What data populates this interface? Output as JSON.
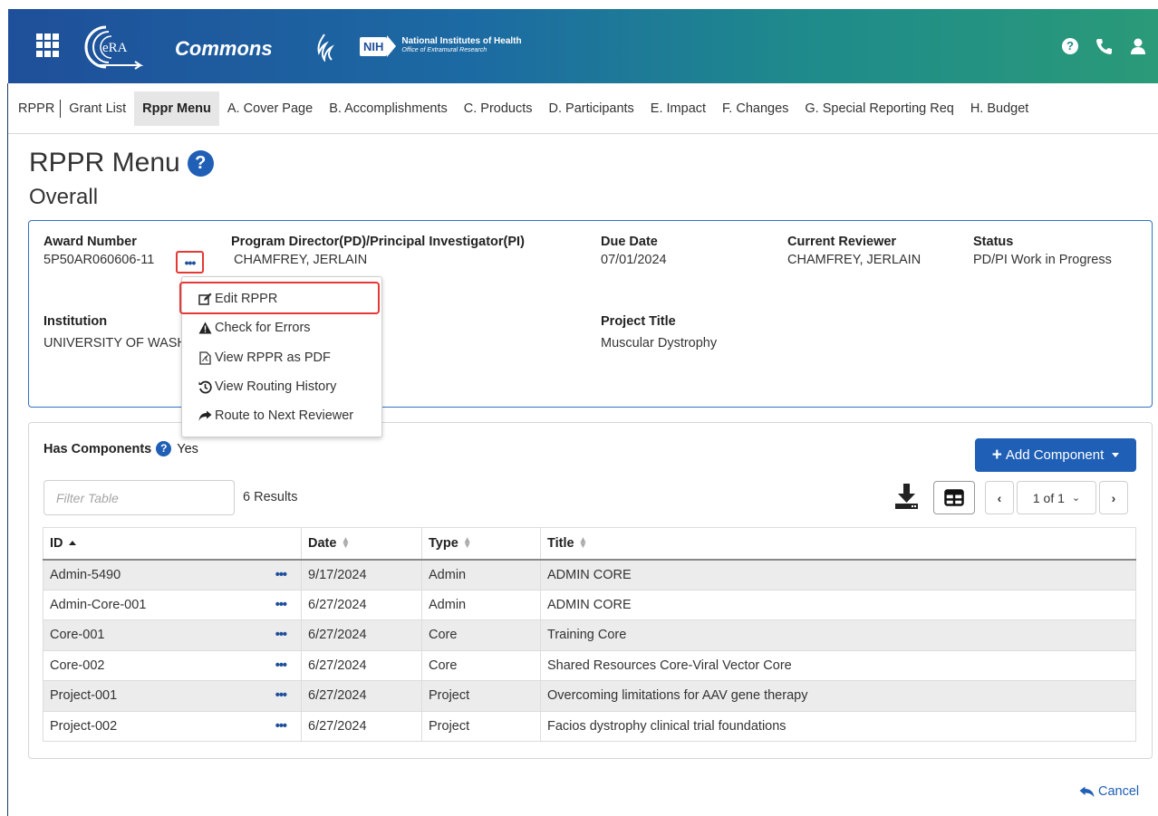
{
  "header": {
    "app_name": "Commons",
    "era_logo_text": "eRA",
    "nih_abbrev": "NIH",
    "nih_name": "National Institutes of Health",
    "nih_office": "Office of Extramural Research",
    "help_icon": "question-circle-icon",
    "brand_colors": [
      "#1f4f9a",
      "#1f8b8b",
      "#2a9a78"
    ]
  },
  "nav": {
    "items": [
      {
        "label": "RPPR"
      },
      {
        "label": "Grant List"
      },
      {
        "label": "Rppr Menu"
      },
      {
        "label": "A. Cover Page"
      },
      {
        "label": "B. Accomplishments"
      },
      {
        "label": "C. Products"
      },
      {
        "label": "D. Participants"
      },
      {
        "label": "E. Impact"
      },
      {
        "label": "F. Changes"
      },
      {
        "label": "G. Special Reporting Req"
      },
      {
        "label": "H. Budget"
      }
    ],
    "active_index": 2
  },
  "page": {
    "title": "RPPR Menu",
    "subtitle": "Overall",
    "help_symbol": "?"
  },
  "info": {
    "award_number_label": "Award Number",
    "award_number": "5P50AR060606-11",
    "pi_label": "Program Director(PD)/Principal Investigator(PI)",
    "pi_value": "CHAMFREY, JERLAIN",
    "due_date_label": "Due Date",
    "due_date": "07/01/2024",
    "reviewer_label": "Current Reviewer",
    "reviewer": "CHAMFREY, JERLAIN",
    "status_label": "Status",
    "status": "PD/PI Work in Progress",
    "institution_label": "Institution",
    "institution": "UNIVERSITY OF WASH",
    "project_title_label": "Project Title",
    "project_title": "Muscular Dystrophy",
    "actions_symbol": "•••"
  },
  "actions_menu": {
    "items": [
      {
        "label": "Edit RPPR",
        "icon": "edit-icon"
      },
      {
        "label": "Check for Errors",
        "icon": "warning-icon"
      },
      {
        "label": "View RPPR as PDF",
        "icon": "pdf-file-icon"
      },
      {
        "label": "View Routing History",
        "icon": "history-icon"
      },
      {
        "label": "Route to Next Reviewer",
        "icon": "share-arrow-icon"
      }
    ],
    "highlighted": "Edit RPPR"
  },
  "components": {
    "has_components_label": "Has Components",
    "has_components_value": "Yes",
    "add_button_label": "Add Component",
    "filter_placeholder": "Filter Table",
    "results_text": "6 Results",
    "pager_text": "1 of 1",
    "columns": [
      "ID",
      "Date",
      "Type",
      "Title"
    ],
    "rows": [
      {
        "id": "Admin-5490",
        "date": "9/17/2024",
        "type": "Admin",
        "title": "ADMIN CORE"
      },
      {
        "id": "Admin-Core-001",
        "date": "6/27/2024",
        "type": "Admin",
        "title": "ADMIN CORE"
      },
      {
        "id": "Core-001",
        "date": "6/27/2024",
        "type": "Core",
        "title": "Training Core"
      },
      {
        "id": "Core-002",
        "date": "6/27/2024",
        "type": "Core",
        "title": "Shared Resources Core-Viral Vector Core"
      },
      {
        "id": "Project-001",
        "date": "6/27/2024",
        "type": "Project",
        "title": "Overcoming limitations for AAV gene therapy"
      },
      {
        "id": "Project-002",
        "date": "6/27/2024",
        "type": "Project",
        "title": "Facios dystrophy clinical trial foundations"
      }
    ],
    "row_actions_symbol": "•••"
  },
  "footer": {
    "cancel_label": "Cancel"
  }
}
